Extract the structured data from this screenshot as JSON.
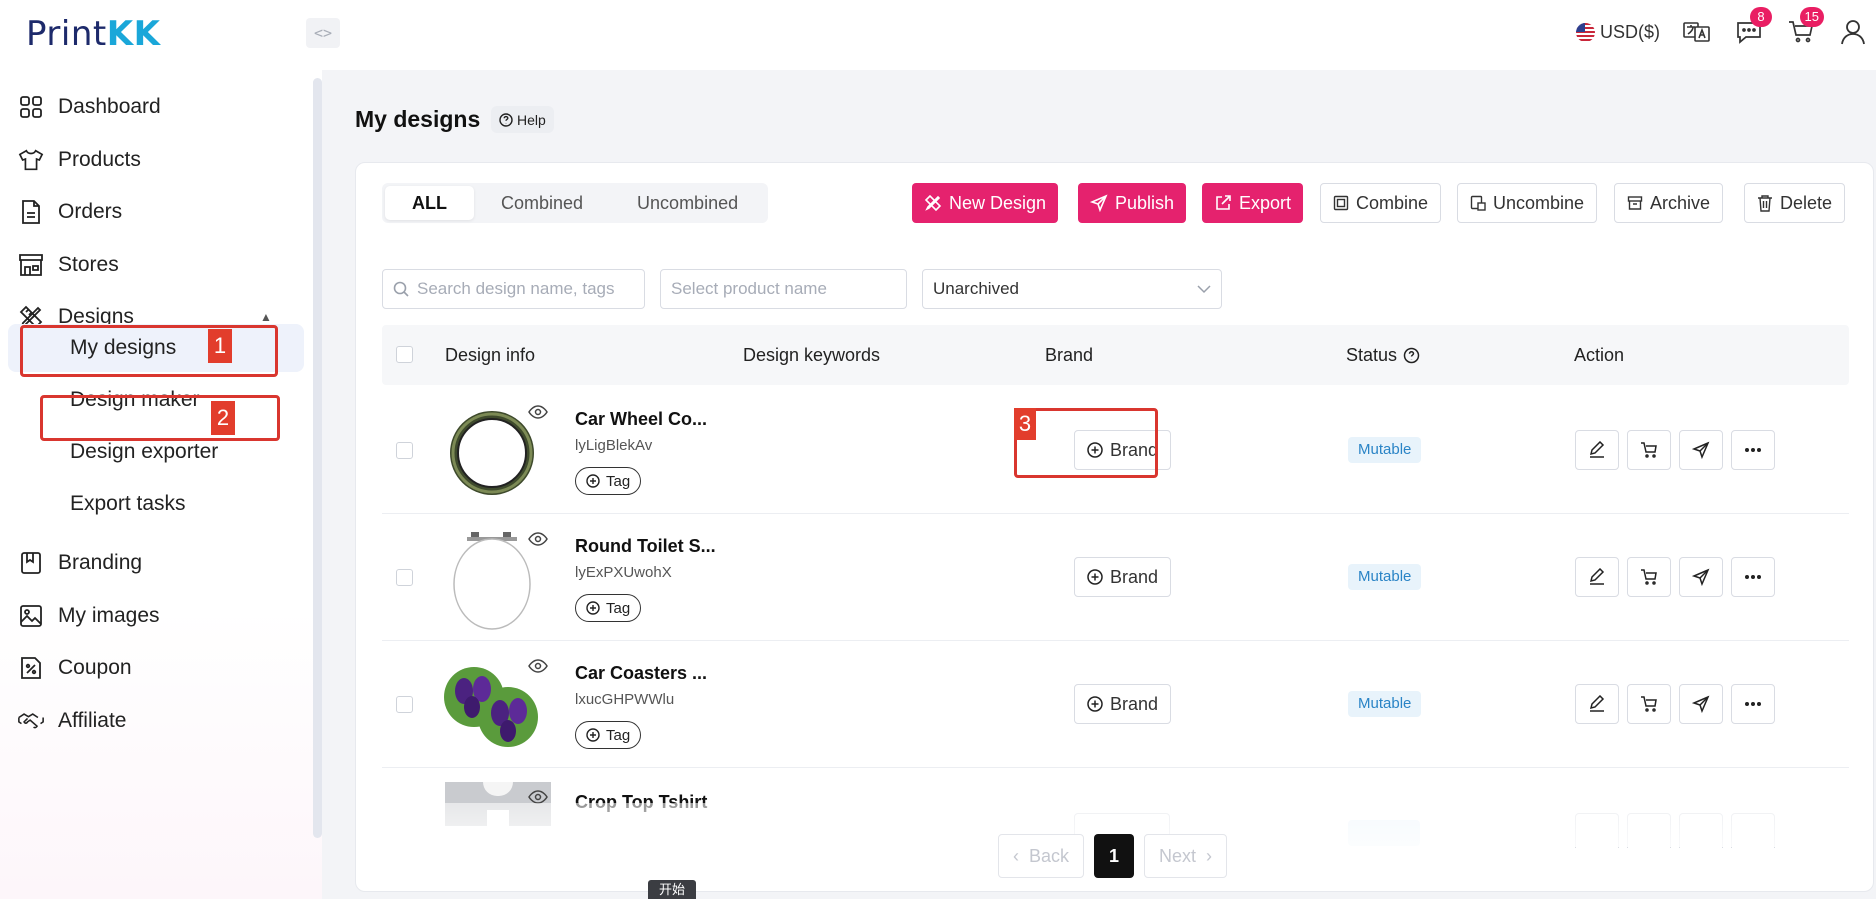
{
  "app": {
    "logo_part1": "Print",
    "logo_part2": "KK",
    "collapse_glyph": "<>"
  },
  "header": {
    "currency": "USD($)",
    "messages_count": "8",
    "cart_count": "15"
  },
  "sidebar": {
    "items": [
      {
        "label": "Dashboard",
        "icon": "grid-icon"
      },
      {
        "label": "Products",
        "icon": "tshirt-icon"
      },
      {
        "label": "Orders",
        "icon": "document-icon"
      },
      {
        "label": "Stores",
        "icon": "store-icon"
      },
      {
        "label": "Designs",
        "icon": "pen-ruler-icon"
      },
      {
        "label": "Branding",
        "icon": "book-icon"
      },
      {
        "label": "My images",
        "icon": "image-icon"
      },
      {
        "label": "Coupon",
        "icon": "coupon-icon"
      },
      {
        "label": "Affiliate",
        "icon": "handshake-icon"
      }
    ],
    "sub_items": [
      "My designs",
      "Design maker",
      "Design exporter",
      "Export tasks"
    ]
  },
  "annotations": [
    "1",
    "2",
    "3"
  ],
  "page": {
    "title": "My designs",
    "help": "Help"
  },
  "tabs": [
    "ALL",
    "Combined",
    "Uncombined"
  ],
  "toolbar": {
    "new_design": "New Design",
    "publish": "Publish",
    "export": "Export",
    "combine": "Combine",
    "uncombine": "Uncombine",
    "archive": "Archive",
    "delete": "Delete"
  },
  "filters": {
    "search_placeholder": "Search design name, tags",
    "product_placeholder": "Select product name",
    "archive_status": "Unarchived"
  },
  "table": {
    "headers": [
      "Design info",
      "Design keywords",
      "Brand",
      "Status",
      "Action"
    ],
    "rows": [
      {
        "name": "Car Wheel Co...",
        "id": "lyLigBlekAv",
        "tag": "Tag",
        "brand": "Brand",
        "status": "Mutable"
      },
      {
        "name": "Round Toilet S...",
        "id": "lyExPXUwohX",
        "tag": "Tag",
        "brand": "Brand",
        "status": "Mutable"
      },
      {
        "name": "Car Coasters ...",
        "id": "lxucGHPWWlu",
        "tag": "Tag",
        "brand": "Brand",
        "status": "Mutable"
      },
      {
        "name": "Crop Top Tshirt"
      }
    ]
  },
  "pagination": {
    "back": "Back",
    "current": "1",
    "next": "Next"
  },
  "tooltip": "开始",
  "colors": {
    "primary": "#e5226e",
    "annotation": "#d9362f",
    "status_text": "#2a84c6",
    "logo_dark": "#1d2a6b",
    "logo_accent": "#1aa7d9"
  }
}
